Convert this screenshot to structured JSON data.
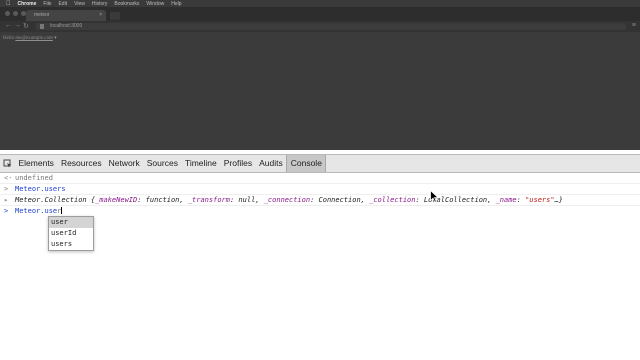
{
  "menubar": {
    "items": [
      "Chrome",
      "File",
      "Edit",
      "View",
      "History",
      "Bookmarks",
      "Window",
      "Help"
    ]
  },
  "browser": {
    "tab_title": "meteor",
    "url": "localhost:3000",
    "page_text_prefix": "Hello ",
    "page_text_link": "me@example.com"
  },
  "devtools": {
    "tabs": [
      {
        "label": "Elements",
        "active": false
      },
      {
        "label": "Resources",
        "active": false
      },
      {
        "label": "Network",
        "active": false
      },
      {
        "label": "Sources",
        "active": false
      },
      {
        "label": "Timeline",
        "active": false
      },
      {
        "label": "Profiles",
        "active": false
      },
      {
        "label": "Audits",
        "active": false
      },
      {
        "label": "Console",
        "active": true
      }
    ]
  },
  "console": {
    "result_prefix": "<·",
    "input_prefix": ">",
    "line1": "undefined",
    "line2": "Meteor.users",
    "line3": {
      "head": "Meteor.Collection {",
      "k1": "_makeNewID",
      "v1": "function",
      "k2": "_transform",
      "v2": "null",
      "k3": "_connection",
      "v3": "Connection",
      "k4": "_collection",
      "v4": "LocalCollection",
      "k5": "_name",
      "v5": "\"users\"",
      "tail": "…}"
    },
    "input_typed": "Meteor.use",
    "input_suggest": "r"
  },
  "autocomplete": {
    "items": [
      "user",
      "userId",
      "users"
    ],
    "selected_index": 0
  }
}
